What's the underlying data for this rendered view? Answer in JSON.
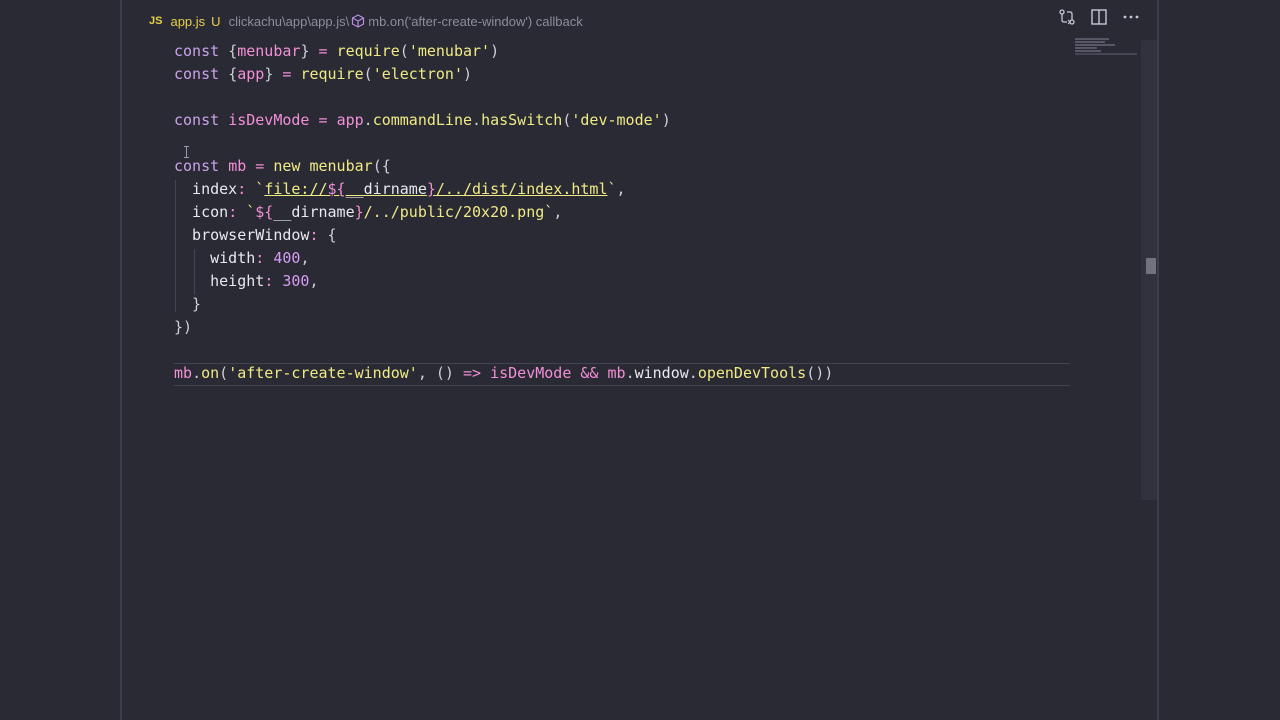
{
  "breadcrumb": {
    "lang_icon": "JS",
    "file": "app.js",
    "status": "U",
    "path": "clickachu\\app\\app.js\\",
    "symbol": "mb.on('after-create-window') callback"
  },
  "icons": {
    "symbol": "function-cube-icon",
    "compare": "compare-changes-icon",
    "split": "split-editor-icon",
    "more": "more-actions-icon"
  },
  "code": {
    "l1": {
      "a": "const ",
      "b": "{",
      "c": "menubar",
      "d": "} ",
      "e": "= ",
      "f": "require",
      "g": "(",
      "h": "'menubar'",
      "i": ")"
    },
    "l2": {
      "a": "const ",
      "b": "{",
      "c": "app",
      "d": "} ",
      "e": "= ",
      "f": "require",
      "g": "(",
      "h": "'electron'",
      "i": ")"
    },
    "l4": {
      "a": "const ",
      "b": "isDevMode ",
      "c": "= ",
      "d": "app",
      "e": ".",
      "f": "commandLine",
      "g": ".",
      "h": "hasSwitch",
      "i": "(",
      "j": "'dev-mode'",
      "k": ")"
    },
    "l6": {
      "a": "const ",
      "b": "mb ",
      "c": "= ",
      "d": "new ",
      "e": "menubar",
      "f": "({"
    },
    "l7": {
      "a": "  index",
      "b": ": ",
      "c": "`",
      "d": "file://",
      "e": "${",
      "f": "__dirname",
      "g": "}",
      "h": "/../dist/index.html",
      "i": "`",
      "j": ","
    },
    "l8": {
      "a": "  icon",
      "b": ": ",
      "c": "`",
      "d": "${",
      "e": "__dirname",
      "f": "}",
      "g": "/../public/20x20.png",
      "h": "`",
      "i": ","
    },
    "l9": {
      "a": "  browserWindow",
      "b": ": ",
      "c": "{"
    },
    "l10": {
      "a": "    width",
      "b": ": ",
      "c": "400",
      "d": ","
    },
    "l11": {
      "a": "    height",
      "b": ": ",
      "c": "300",
      "d": ","
    },
    "l12": {
      "a": "  }"
    },
    "l13": {
      "a": "})"
    },
    "l15": {
      "a": "mb",
      "b": ".",
      "c": "on",
      "d": "(",
      "e": "'after-create-window'",
      "f": ", ",
      "g": "() ",
      "h": "=> ",
      "i": "isDevMode ",
      "j": "&& ",
      "k": "mb",
      "l": ".",
      "m": "window",
      "n": ".",
      "o": "openDevTools",
      "p": "())"
    }
  },
  "colors": {
    "background": "#2a2a35",
    "keyword": "#c9a3e8",
    "string": "#f0ea84",
    "variable": "#f28fd6",
    "number": "#d59df2",
    "file_label": "#e9d04a"
  }
}
